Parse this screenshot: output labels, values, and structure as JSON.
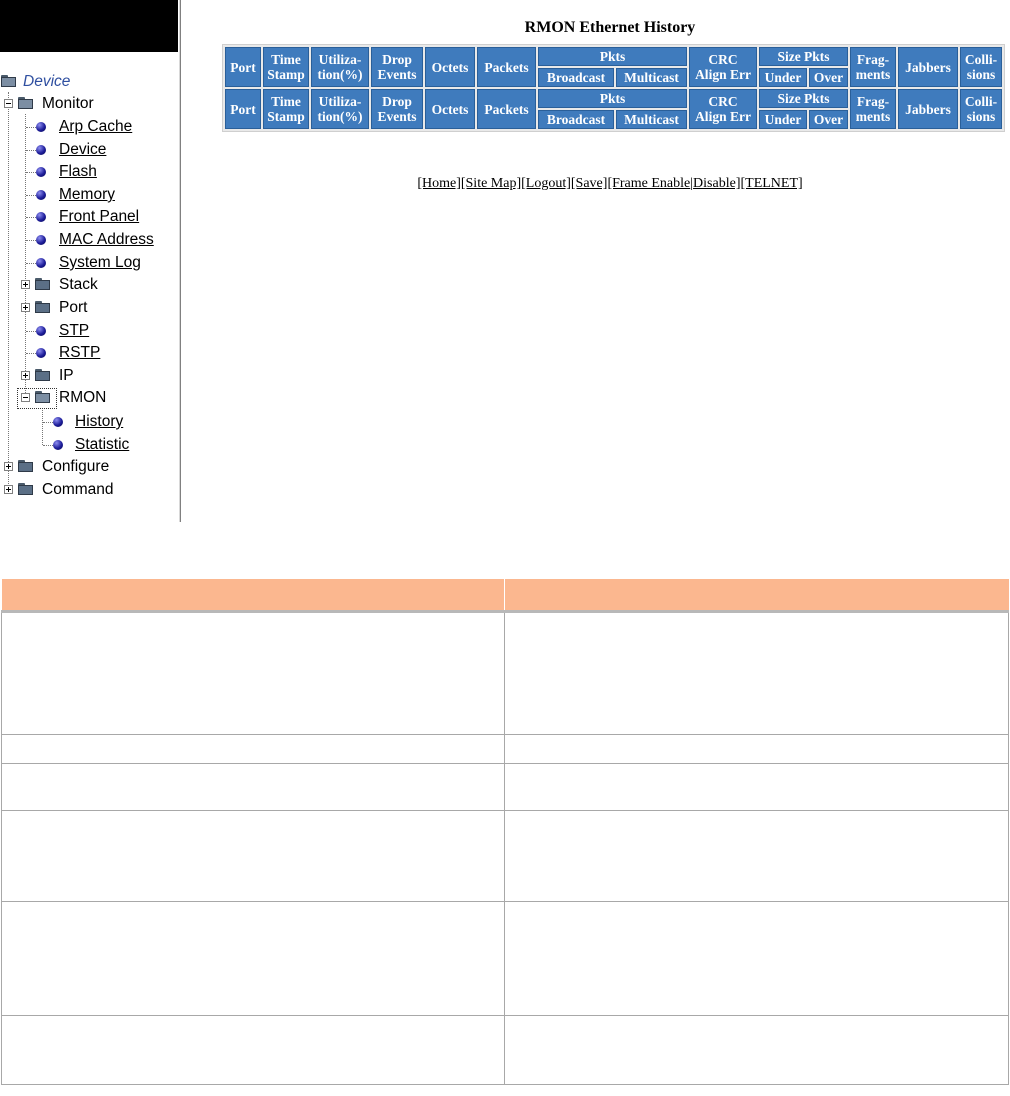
{
  "tree": {
    "root": "Device",
    "monitor": "Monitor",
    "monitor_items": [
      "Arp Cache",
      "Device",
      "Flash",
      "Memory",
      "Front Panel",
      "MAC Address",
      "System Log"
    ],
    "stack": "Stack",
    "port": "Port",
    "stp": "STP",
    "rstp": "RSTP",
    "ip": "IP",
    "rmon": "RMON",
    "rmon_items": [
      "History",
      "Statistic"
    ],
    "configure": "Configure",
    "command": "Command"
  },
  "main": {
    "title": "RMON Ethernet History",
    "headers": {
      "port": "Port",
      "time_stamp_1": "Time",
      "time_stamp_2": "Stamp",
      "utilization_1": "Utiliza-",
      "utilization_2": "tion(%)",
      "drop_events_1": "Drop",
      "drop_events_2": "Events",
      "octets": "Octets",
      "packets": "Packets",
      "pkts": "Pkts",
      "broadcast": "Broadcast",
      "multicast": "Multicast",
      "crc_1": "CRC",
      "crc_2": "Align Err",
      "size_pkts": "Size Pkts",
      "under": "Under",
      "over": "Over",
      "fragments_1": "Frag-",
      "fragments_2": "ments",
      "jabbers": "Jabbers",
      "collisions_1": "Colli-",
      "collisions_2": "sions"
    },
    "nav_links": [
      "[Home]",
      "[Site Map]",
      "[Logout]",
      "[Save]",
      "[Frame Enable",
      "|",
      "Disable]",
      "[TELNET]"
    ]
  },
  "colors": {
    "header_blue": "#3f7bbd",
    "doc_header_peach": "#fbb78f"
  }
}
